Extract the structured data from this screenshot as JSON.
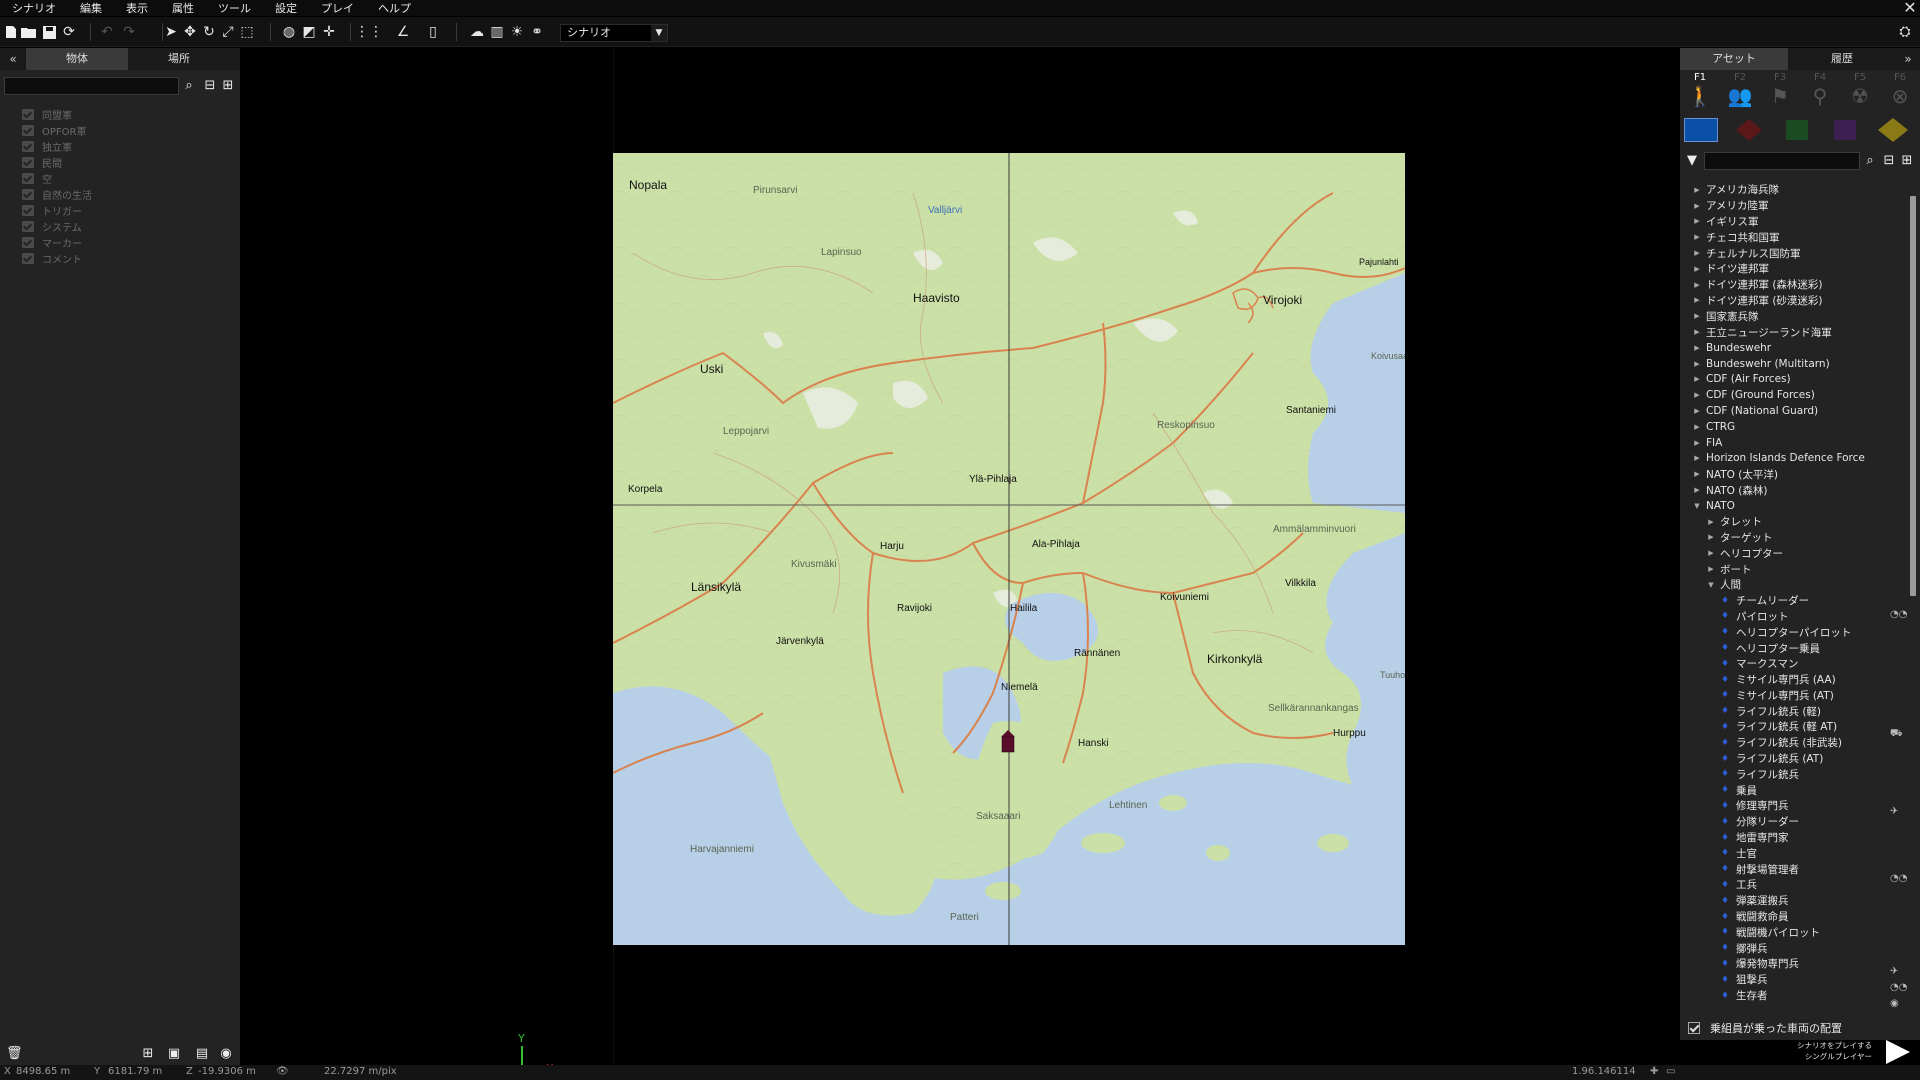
{
  "menu": [
    "シナリオ",
    "編集",
    "表示",
    "属性",
    "ツール",
    "設定",
    "プレイ",
    "ヘルプ"
  ],
  "toolbar": {
    "mode_select": "シナリオ"
  },
  "left_panel": {
    "tabs": [
      "物体",
      "場所"
    ],
    "layers": [
      "同盟軍",
      "OPFOR軍",
      "独立軍",
      "民間",
      "空",
      "自然の生活",
      "トリガー",
      "システム",
      "マーカー",
      "コメント"
    ]
  },
  "map": {
    "labels": {
      "nopala": "Nopala",
      "pirunsarvi": "Pirunsarvi",
      "valljarvi": "Valljärvi",
      "lapinsuo": "Lapinsuo",
      "haavisto": "Haavisto",
      "virojoki": "Virojoki",
      "pajunlahti": "Pajunlahti",
      "uski": "Uski",
      "koivusaari": "Koivusaari",
      "santaniemi": "Santaniemi",
      "leppojarvi": "Leppojarvi",
      "reskopinsuo": "Reskopinsuo",
      "yla_pihlaja": "Ylä-Pihlaja",
      "korpela": "Korpela",
      "ammalamminvuori": "Ammälamminvuori",
      "harju": "Harju",
      "ala_pihlaja": "Ala-Pihlaja",
      "kivusmaki": "Kivusmäki",
      "lansikyla": "Länsikylä",
      "vilkkila": "Vilkkila",
      "koivuniemi": "Koivuniemi",
      "ravijoki": "Ravijoki",
      "hailila": "Hailila",
      "jarvenkyla": "Järvenkylä",
      "rannanen": "Rännänen",
      "kirkonkyla": "Kirkonkylä",
      "tuuholmi": "Tuuholmi",
      "niemela": "Niemelä",
      "sellkarannankangas": "Sellkärannankangas",
      "hurppu": "Hurppu",
      "hanski": "Hanski",
      "lehtinen": "Lehtinen",
      "saksaaari": "Saksaaari",
      "harvajanniemi": "Harvajanniemi",
      "patteri": "Patteri"
    }
  },
  "axis": {
    "y": "Y",
    "x": "X"
  },
  "right_panel": {
    "tabs": [
      "アセット",
      "履歴"
    ],
    "fkeys": [
      "F1",
      "F2",
      "F3",
      "F4",
      "F5",
      "F6"
    ],
    "side_colors": [
      "#0a4fa8",
      "#5a1818",
      "#1b4b20",
      "#3e1f52",
      "#8a7a15"
    ],
    "tree_top": [
      "アメリカ海兵隊",
      "アメリカ陸軍",
      "イギリス軍",
      "チェコ共和国軍",
      "チェルナルス国防軍",
      "ドイツ連邦軍",
      "ドイツ連邦軍 (森林迷彩)",
      "ドイツ連邦軍 (砂漠迷彩)",
      "国家憲兵隊",
      "王立ニュージーランド海軍",
      "Bundeswehr",
      "Bundeswehr (Multitarn)",
      "CDF (Air Forces)",
      "CDF (Ground Forces)",
      "CDF (National Guard)",
      "CTRG",
      "FIA",
      "Horizon Islands Defence Force",
      "NATO (太平洋)",
      "NATO (森林)",
      "NATO"
    ],
    "tree_nato": [
      "タレット",
      "ターゲット",
      "ヘリコプター",
      "ボート",
      "人間"
    ],
    "tree_units": [
      "チームリーダー",
      "パイロット",
      "ヘリコプターパイロット",
      "ヘリコプター乗員",
      "マークスマン",
      "ミサイル専門兵 (AA)",
      "ミサイル専門兵 (AT)",
      "ライフル銃兵 (軽)",
      "ライフル銃兵 (軽 AT)",
      "ライフル銃兵 (非武装)",
      "ライフル銃兵 (AT)",
      "ライフル銃兵",
      "乗員",
      "修理専門兵",
      "分隊リーダー",
      "地雷専門家",
      "士官",
      "射撃場管理者",
      "工兵",
      "弾薬運搬兵",
      "戦闘救命員",
      "戦闘機パイロット",
      "擲弾兵",
      "爆発物専門兵",
      "狙撃兵",
      "生存者"
    ],
    "crew_option": "乗組員が乗った車両の配置",
    "play_label": [
      "シナリオをプレイする",
      "シングルプレイヤー"
    ]
  },
  "status": {
    "x": "8498.65 m",
    "y": "6181.79 m",
    "z": "-19.9306 m",
    "scale": "22.7297 m/pix",
    "version": "1.96.146114"
  }
}
